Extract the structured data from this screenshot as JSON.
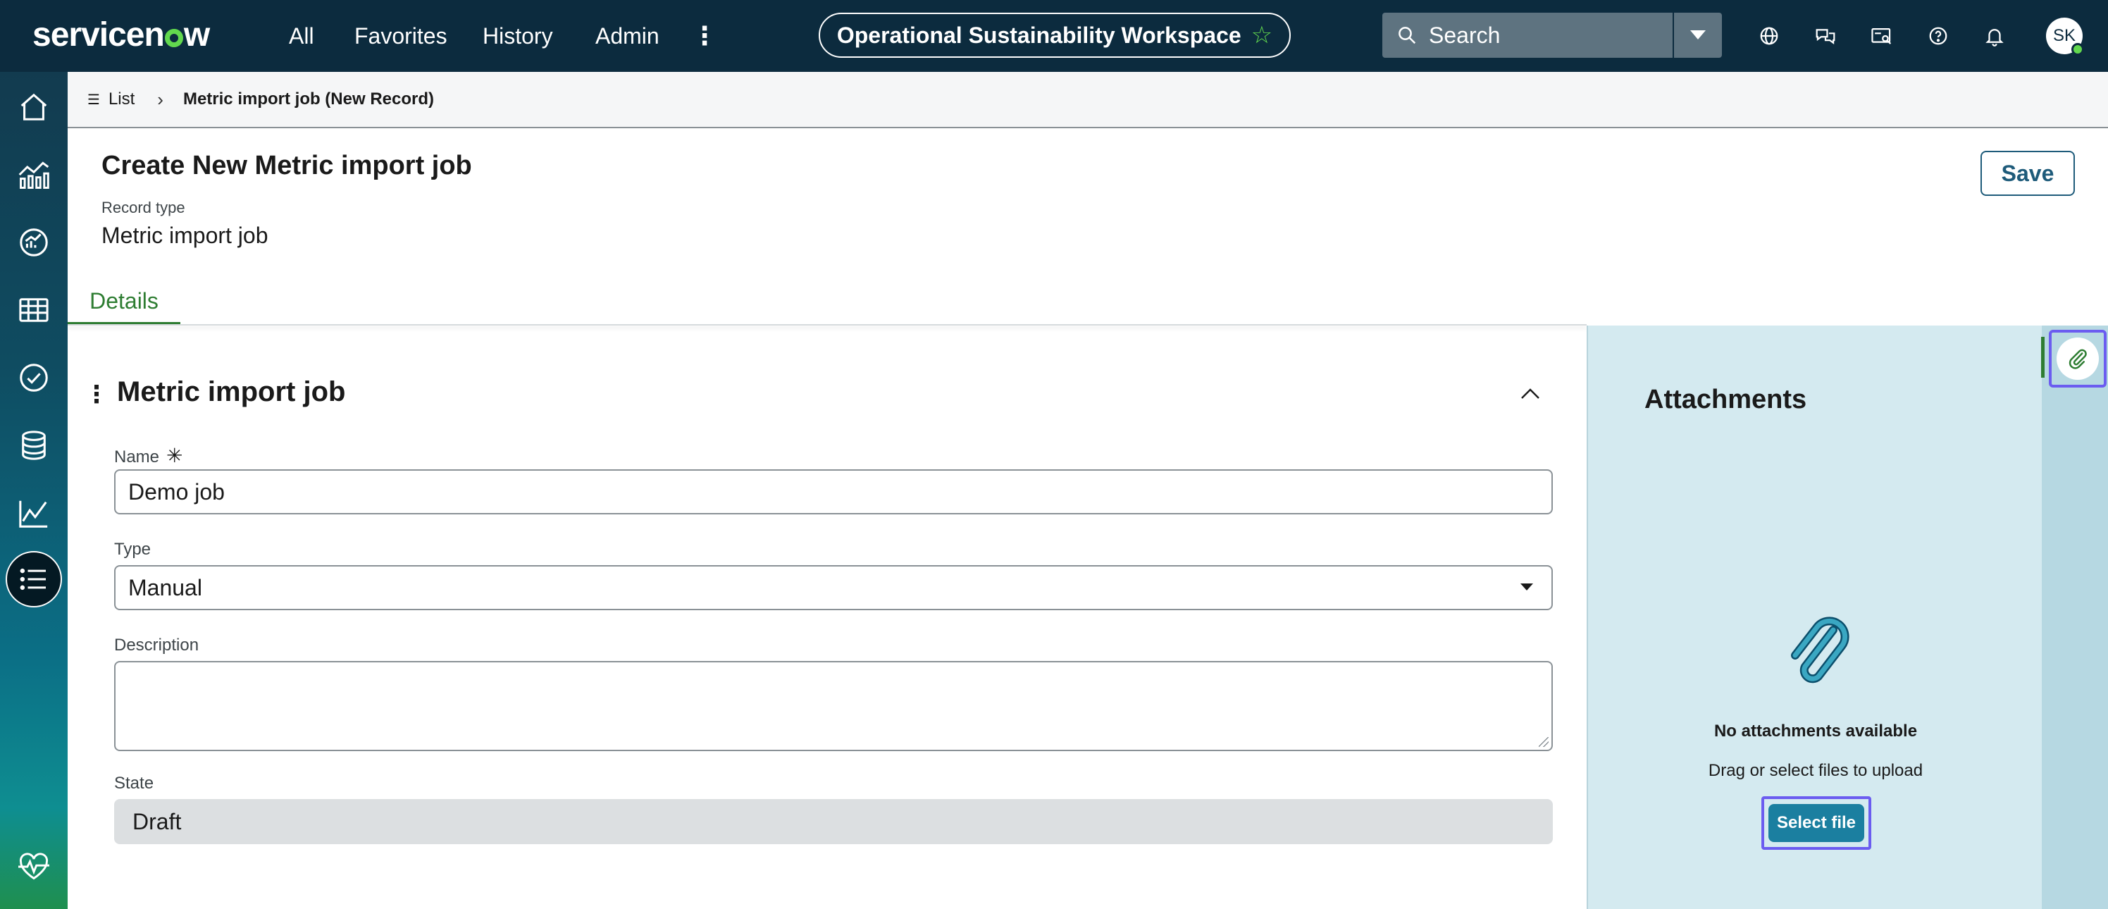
{
  "topbar": {
    "logo_text": "servicenow",
    "nav": {
      "all": "All",
      "favorites": "Favorites",
      "history": "History",
      "admin": "Admin",
      "more": "⋮"
    },
    "workspace_title": "Operational Sustainability Workspace",
    "workspace_star": "☆",
    "search_placeholder": "Search",
    "icons": [
      "globe-icon",
      "chat-icon",
      "card-search-icon",
      "help-icon",
      "bell-icon"
    ],
    "avatar_initials": "SK",
    "colors": {
      "bar": "#0c2b3e",
      "accent_green": "#62d84e"
    }
  },
  "rail": {
    "icons": [
      "home-icon",
      "analytics-icon",
      "dashboard-icon",
      "table-icon",
      "check-circle-icon",
      "database-icon",
      "trend-chart-icon",
      "list-icon",
      "health-icon"
    ],
    "active": "list-icon"
  },
  "breadcrumb": {
    "list_icon": "☰",
    "list_label": "List",
    "separator": "›",
    "current": "Metric import job (New Record)"
  },
  "header": {
    "title": "Create New Metric import job",
    "record_type_label": "Record type",
    "record_type_value": "Metric import job",
    "save_label": "Save"
  },
  "tabs": {
    "details": "Details"
  },
  "form": {
    "section_menu": "⋮",
    "section_title": "Metric import job",
    "name_label": "Name",
    "required_marker": "✳",
    "name_value": "Demo job",
    "type_label": "Type",
    "type_value": "Manual",
    "description_label": "Description",
    "description_value": "",
    "state_label": "State",
    "state_value": "Draft"
  },
  "attachments": {
    "title": "Attachments",
    "empty_text": "No attachments available",
    "hint": "Drag or select files to upload",
    "select_file_label": "Select file",
    "colors": {
      "panel": "#d4eaf0",
      "button": "#1b7fa0",
      "focus_ring": "#6b5cf0"
    }
  }
}
